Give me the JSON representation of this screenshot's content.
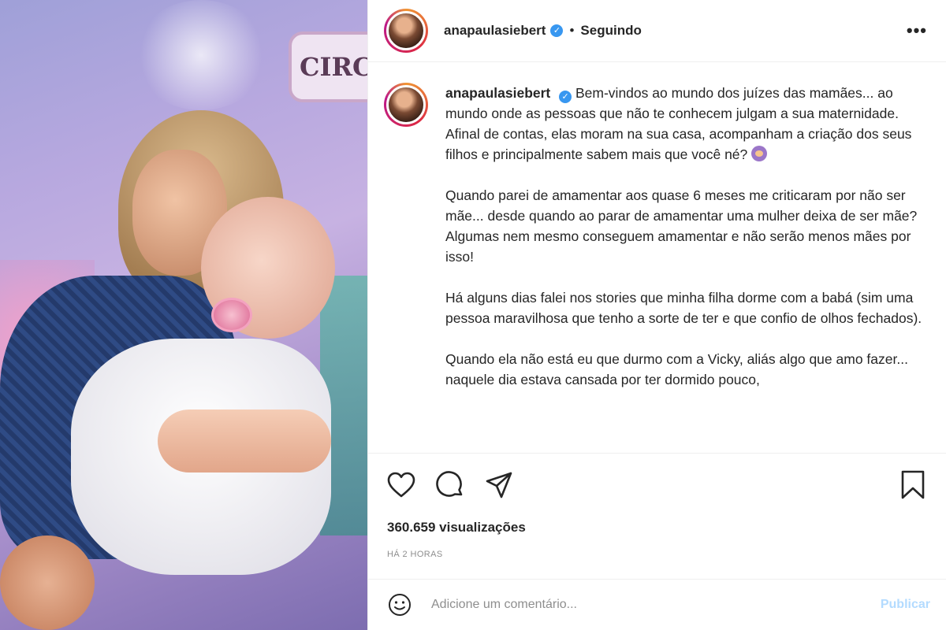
{
  "post": {
    "username": "anapaulasiebert",
    "verified_icon": "✓",
    "separator": "•",
    "following_label": "Seguindo",
    "more_label": "•••",
    "caption_paragraphs": [
      "Bem-vindos ao mundo dos juízes das mamães... ao mundo onde as pessoas que não te conhecem julgam a sua maternidade. Afinal de contas, elas moram na sua casa, acompanham a criação dos seus filhos e principalmente sabem mais que você né?",
      "Quando parei de amamentar aos quase 6 meses me criticaram por não ser mãe... desde quando ao parar de amamentar uma mulher deixa de ser mãe? Algumas nem mesmo conseguem amamentar e não serão menos mães por isso!",
      "Há alguns dias falei nos stories que minha filha dorme com a babá (sim uma pessoa maravilhosa que tenho a sorte de ter e que confio de olhos fechados).",
      "Quando ela não está eu que durmo com a Vicky, aliás algo que amo fazer... naquele dia estava cansada por ter dormido pouco,"
    ],
    "media_sign_text": "CIRC",
    "views": "360.659 visualizações",
    "time": "HÁ 2 HORAS",
    "comment_placeholder": "Adicione um comentário...",
    "publish_label": "Publicar"
  },
  "icons": {
    "like": "heart-icon",
    "comment": "comment-icon",
    "share": "share-icon",
    "save": "bookmark-icon",
    "emoji": "smiley-icon"
  },
  "colors": {
    "verified": "#3897f0",
    "publish_disabled": "#b3dbff",
    "muted": "#8e8e8e"
  }
}
